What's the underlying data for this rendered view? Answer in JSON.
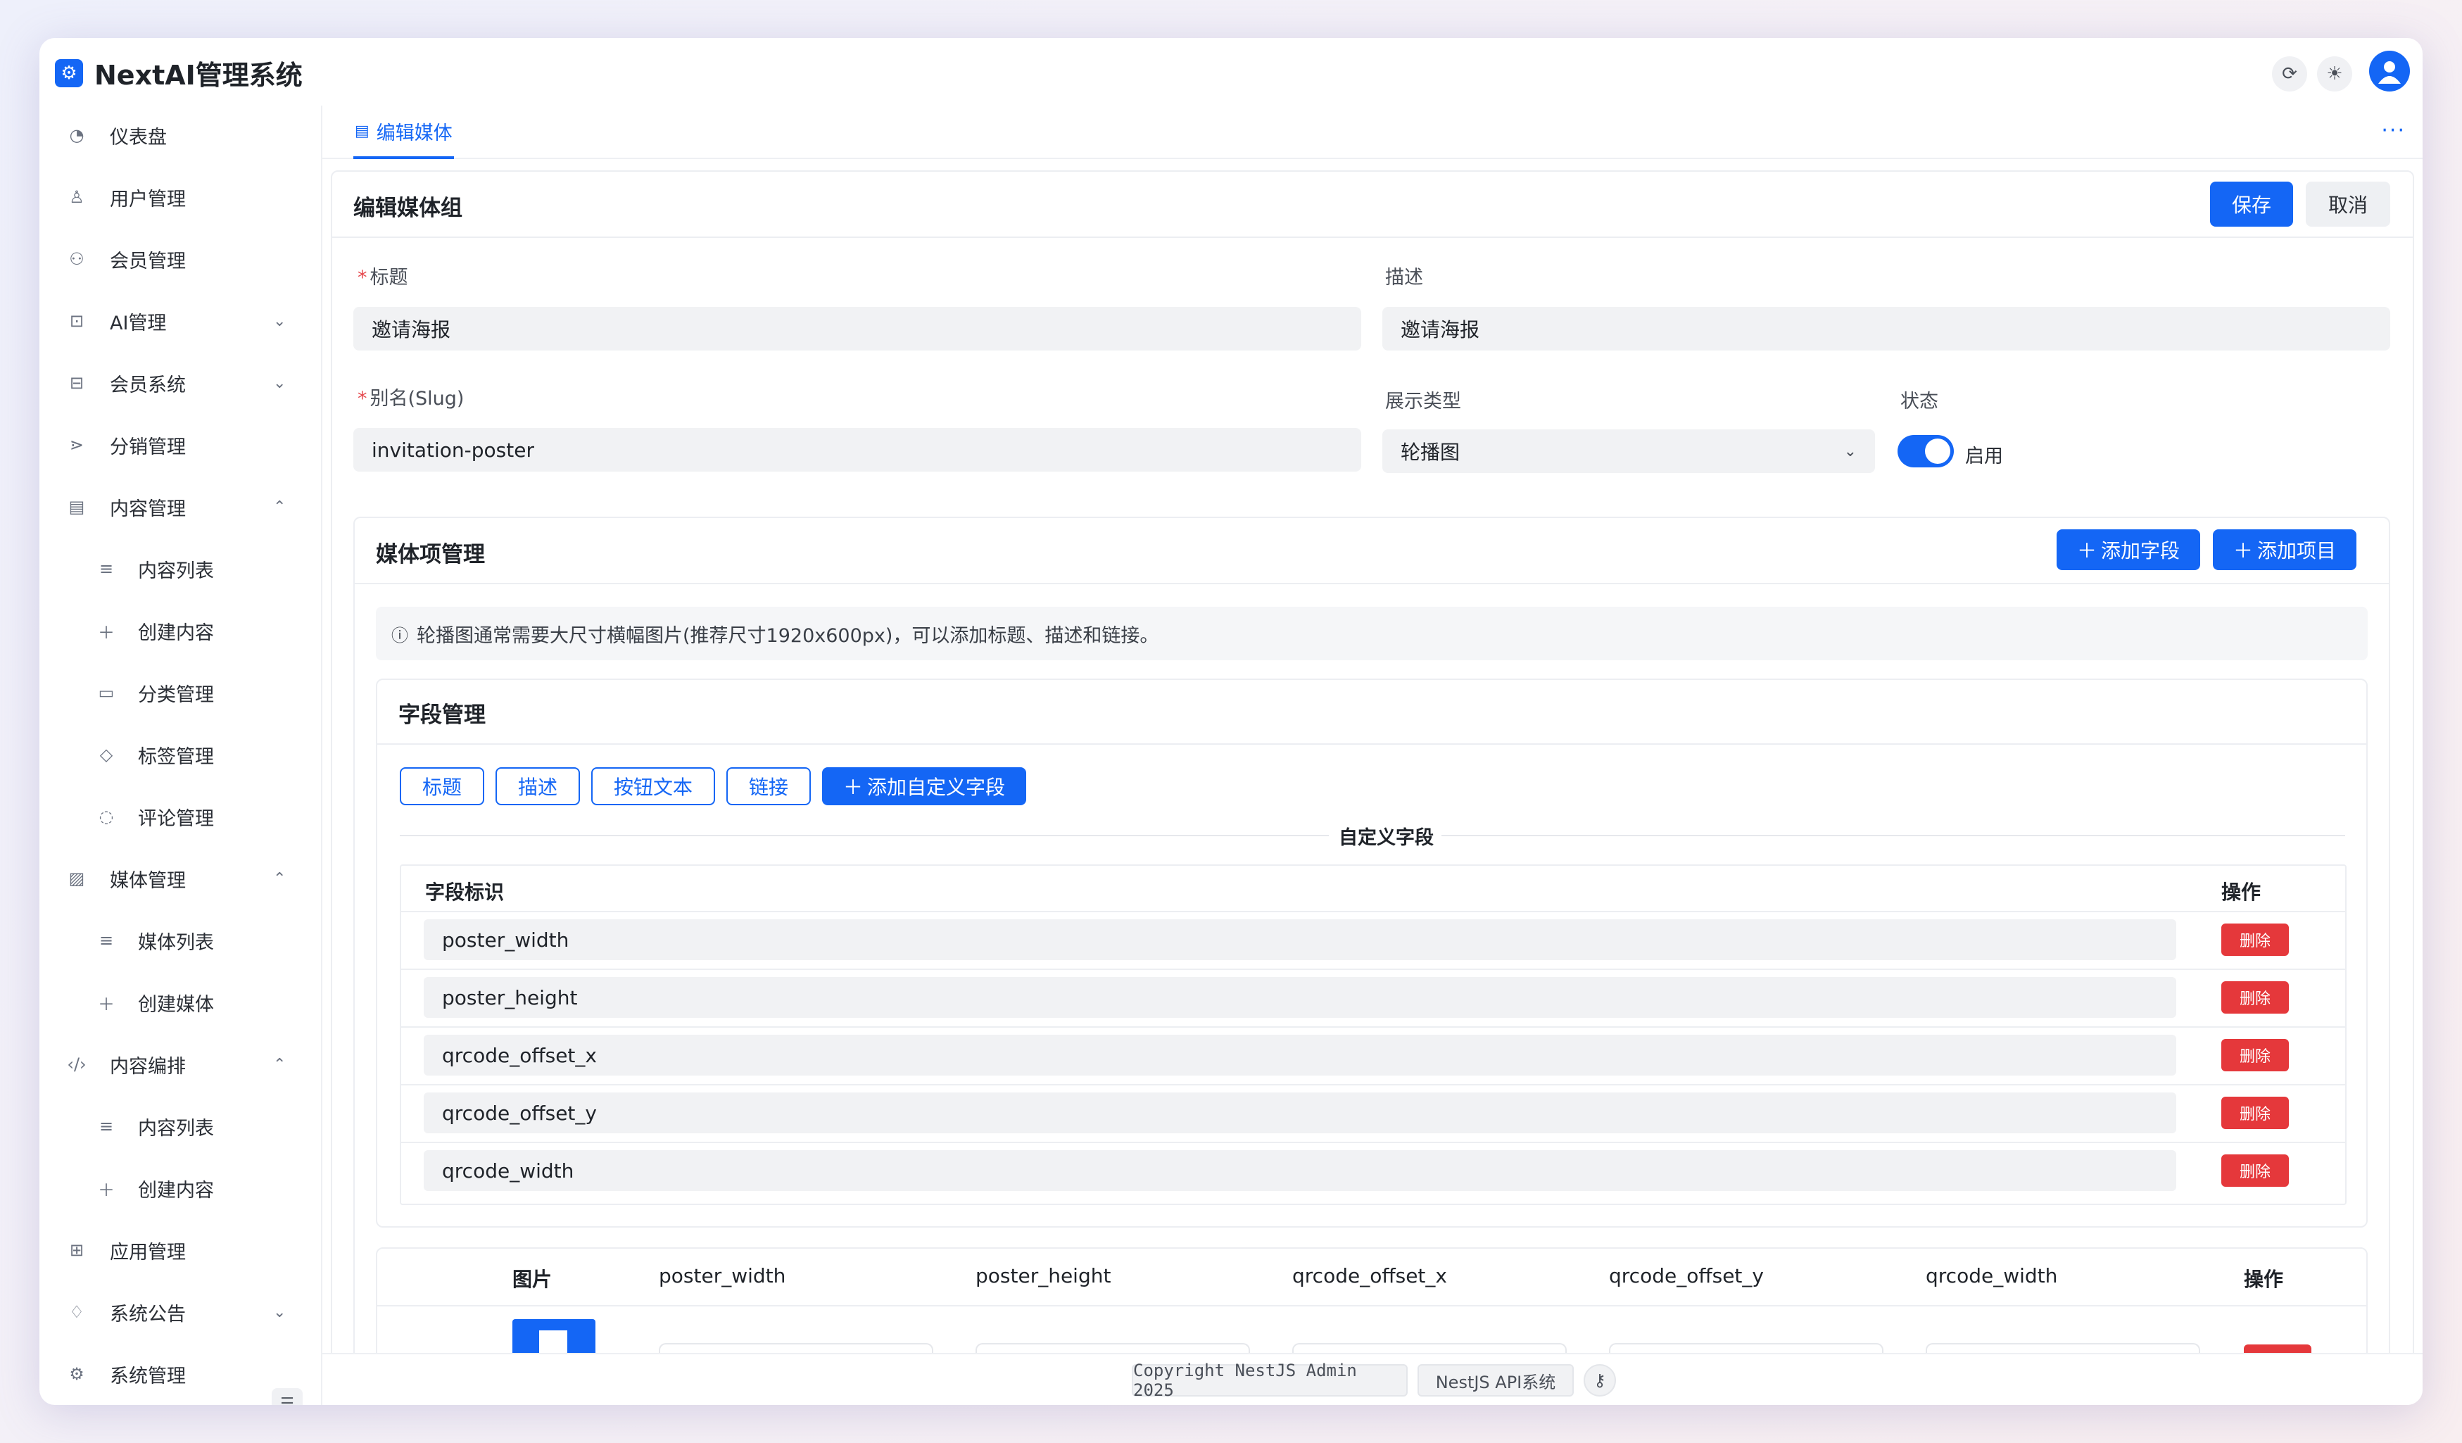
{
  "app": {
    "title": "NextAI管理系统"
  },
  "sidebar": {
    "items": [
      {
        "label": "仪表盘",
        "icon": "dashboard-icon"
      },
      {
        "label": "用户管理",
        "icon": "user-icon"
      },
      {
        "label": "会员管理",
        "icon": "members-icon"
      },
      {
        "label": "AI管理",
        "icon": "robot-icon",
        "chevron": "down"
      },
      {
        "label": "会员系统",
        "icon": "gift-icon",
        "chevron": "down"
      },
      {
        "label": "分销管理",
        "icon": "share-icon"
      },
      {
        "label": "内容管理",
        "icon": "document-icon",
        "chevron": "up"
      },
      {
        "label": "内容列表",
        "icon": "list-icon",
        "sub": true
      },
      {
        "label": "创建内容",
        "icon": "plus-icon",
        "sub": true
      },
      {
        "label": "分类管理",
        "icon": "folder-icon",
        "sub": true
      },
      {
        "label": "标签管理",
        "icon": "tag-icon",
        "sub": true
      },
      {
        "label": "评论管理",
        "icon": "comment-icon",
        "sub": true
      },
      {
        "label": "媒体管理",
        "icon": "image-icon",
        "chevron": "up"
      },
      {
        "label": "媒体列表",
        "icon": "list-icon",
        "sub": true
      },
      {
        "label": "创建媒体",
        "icon": "plus-icon",
        "sub": true
      },
      {
        "label": "内容编排",
        "icon": "code-icon",
        "chevron": "up"
      },
      {
        "label": "内容列表",
        "icon": "list-icon",
        "sub": true
      },
      {
        "label": "创建内容",
        "icon": "plus-icon",
        "sub": true
      },
      {
        "label": "应用管理",
        "icon": "apps-icon"
      },
      {
        "label": "系统公告",
        "icon": "bell-icon",
        "chevron": "down"
      },
      {
        "label": "系统管理",
        "icon": "settings-icon"
      }
    ]
  },
  "tabs": [
    {
      "label": "编辑媒体"
    }
  ],
  "form": {
    "title": "编辑媒体组",
    "save": "保存",
    "cancel": "取消",
    "title_label": "标题",
    "title_value": "邀请海报",
    "desc_label": "描述",
    "desc_value": "邀请海报",
    "slug_label": "别名(Slug)",
    "slug_value": "invitation-poster",
    "display_label": "展示类型",
    "display_value": "轮播图",
    "status_label": "状态",
    "status_value": "启用",
    "status_on": true
  },
  "media": {
    "title": "媒体项管理",
    "add_field": "添加字段",
    "add_item": "添加项目",
    "tip": "轮播图通常需要大尺寸横幅图片(推荐尺寸1920x600px)，可以添加标题、描述和链接。",
    "field_mgmt": {
      "title": "字段管理",
      "preset": [
        "标题",
        "描述",
        "按钮文本",
        "链接"
      ],
      "add_custom": "添加自定义字段",
      "custom_title": "自定义字段",
      "col_key": "字段标识",
      "col_action": "操作",
      "rows": [
        "poster_width",
        "poster_height",
        "qrcode_offset_x",
        "qrcode_offset_y",
        "qrcode_width"
      ],
      "delete": "删除"
    },
    "items_table": {
      "columns": [
        "图片",
        "poster_width",
        "poster_height",
        "qrcode_offset_x",
        "qrcode_offset_y",
        "qrcode_width",
        "操作"
      ]
    }
  },
  "footer": {
    "copyright": "Copyright NestJS Admin 2025",
    "api": "NestJS API系统"
  }
}
